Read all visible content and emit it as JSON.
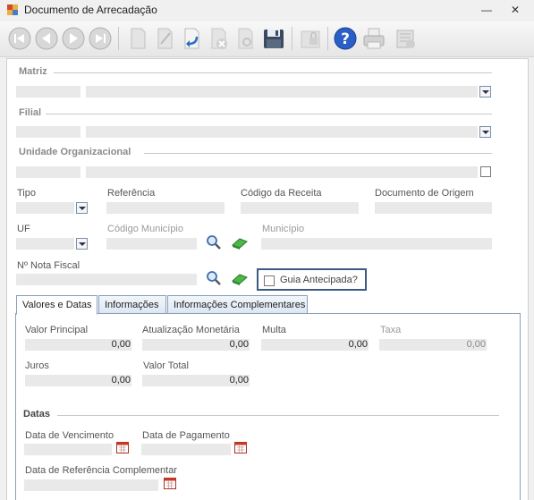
{
  "window": {
    "title": "Documento de Arrecadação",
    "minimize": "—",
    "close": "✕"
  },
  "toolbar": {
    "buttons": [
      "first-record-icon",
      "previous-record-icon",
      "next-record-icon",
      "last-record-icon",
      "new-document-icon",
      "edit-icon",
      "undo-icon",
      "delete-icon",
      "search-document-icon",
      "save-icon",
      "lock-icon",
      "help-icon",
      "print-icon",
      "report-icon"
    ]
  },
  "sections": {
    "matriz": "Matriz",
    "filial": "Filial",
    "unidade": "Unidade Organizacional",
    "datas": "Datas"
  },
  "labels": {
    "tipo": "Tipo",
    "referencia": "Referência",
    "codigo_receita": "Código da Receita",
    "documento_origem": "Documento de Origem",
    "uf": "UF",
    "codigo_municipio": "Código Município",
    "municipio": "Município",
    "nota_fiscal": "Nº Nota Fiscal",
    "guia_antecipada": "Guia Antecipada?"
  },
  "tabs": [
    {
      "label": "Valores e Datas",
      "active": true
    },
    {
      "label": "Informações",
      "active": false
    },
    {
      "label": "Informações Complementares",
      "active": false
    }
  ],
  "valores": {
    "valor_principal": {
      "label": "Valor Principal",
      "value": "0,00"
    },
    "atualizacao": {
      "label": "Atualização Monetária",
      "value": "0,00"
    },
    "multa": {
      "label": "Multa",
      "value": "0,00"
    },
    "taxa": {
      "label": "Taxa",
      "value": "0,00"
    },
    "juros": {
      "label": "Juros",
      "value": "0,00"
    },
    "valor_total": {
      "label": "Valor Total",
      "value": "0,00"
    }
  },
  "datas": {
    "vencimento": "Data de Vencimento",
    "pagamento": "Data de Pagamento",
    "referencia_complementar": "Data de Referência Complementar"
  }
}
